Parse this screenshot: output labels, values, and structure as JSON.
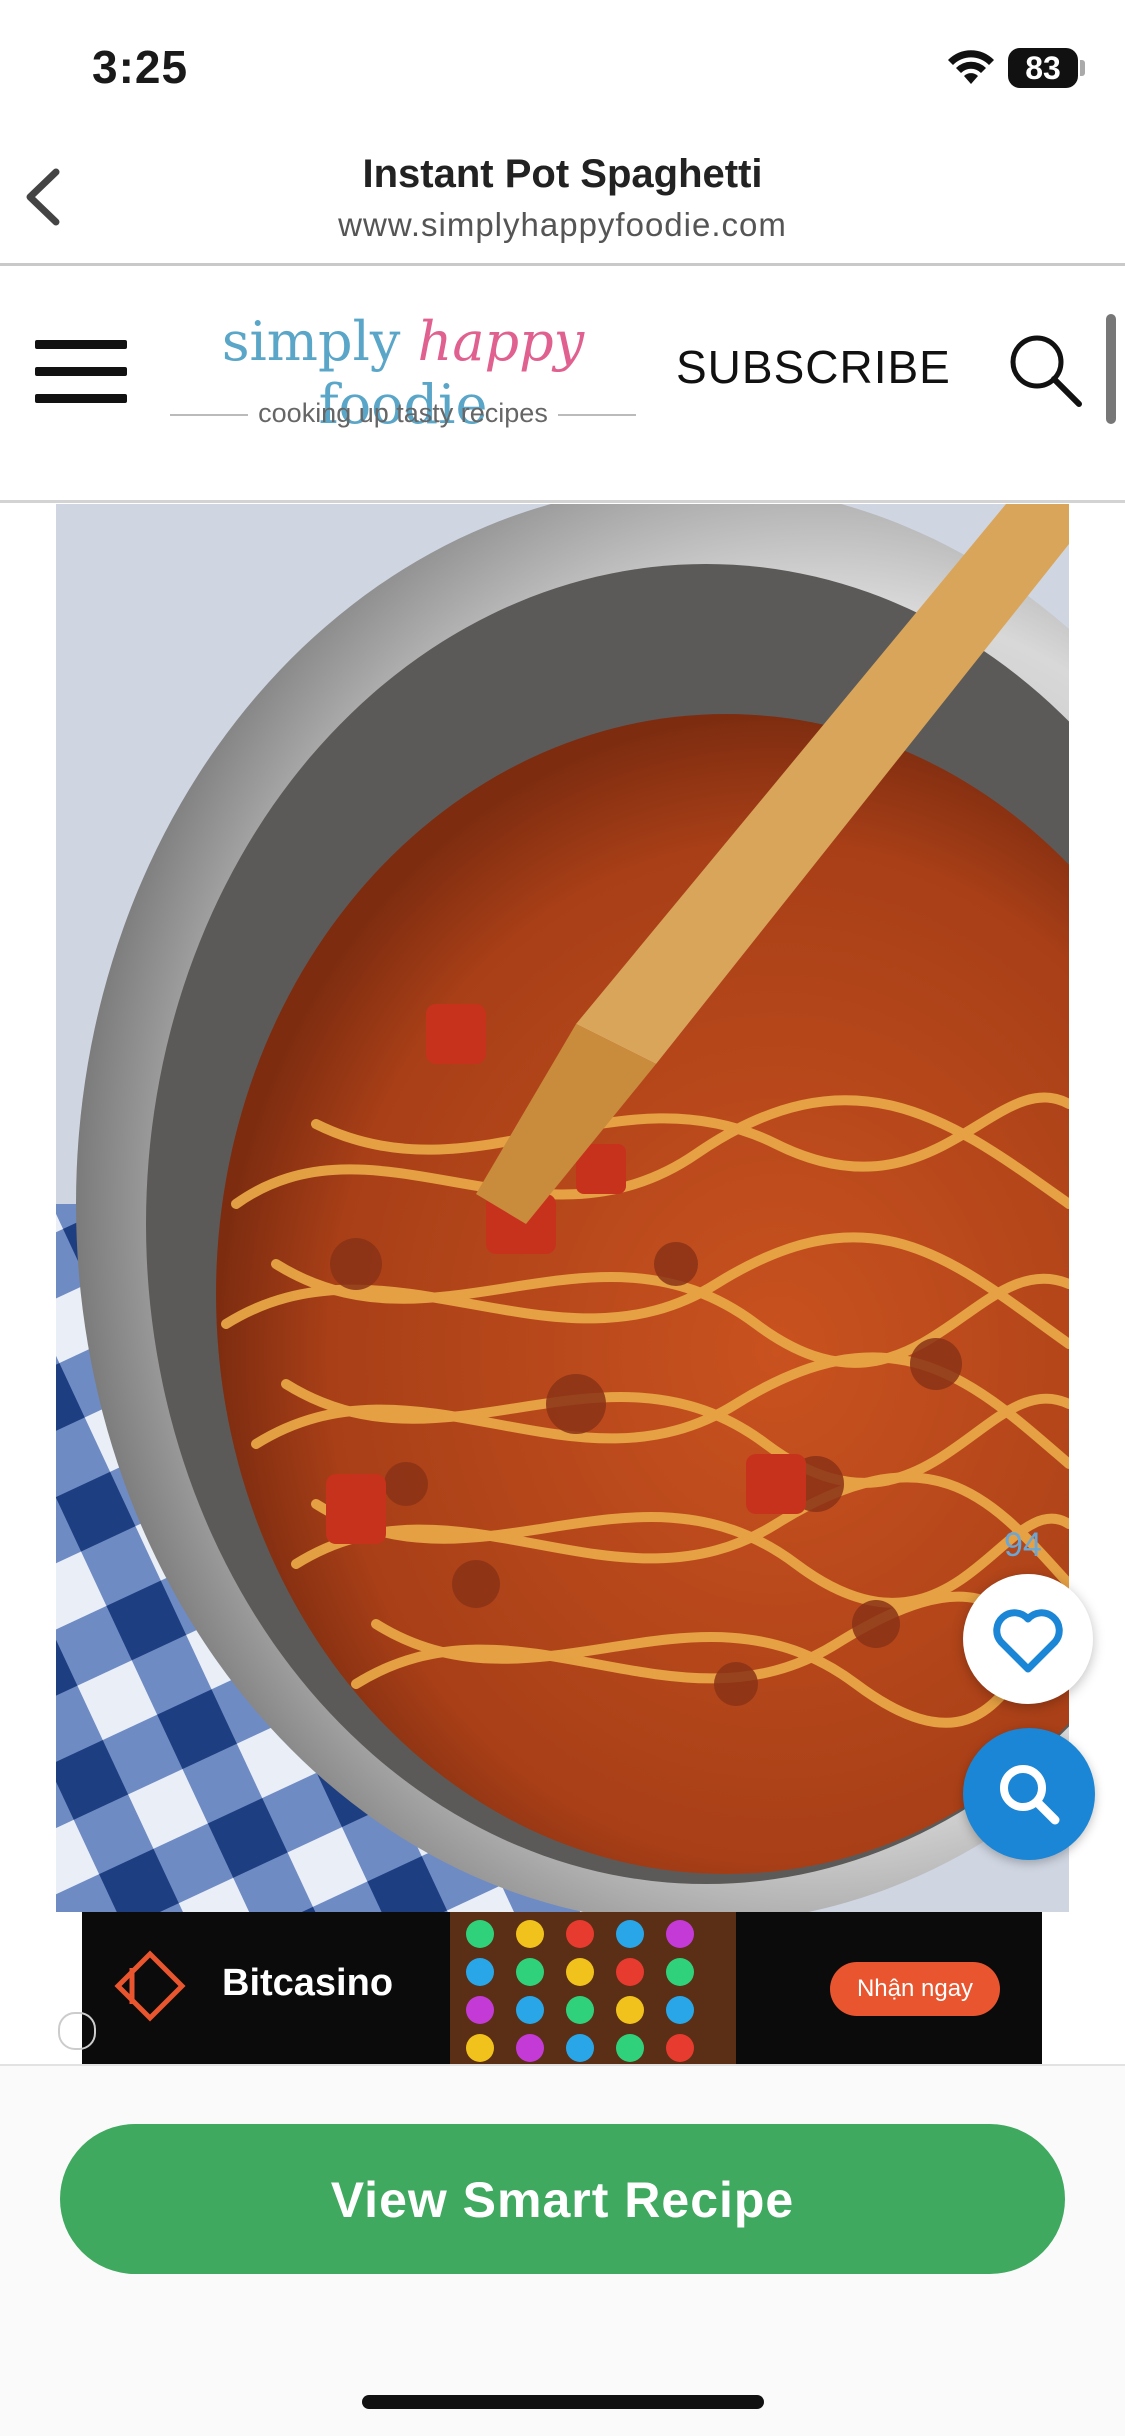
{
  "status_bar": {
    "time": "3:25",
    "battery": "83"
  },
  "nav": {
    "title": "Instant Pot Spaghetti",
    "url": "www.simplyhappyfoodie.com"
  },
  "site_header": {
    "logo_word_1": "simply",
    "logo_word_2": "happy",
    "logo_word_3": "foodie",
    "logo_tagline": "cooking up tasty recipes",
    "subscribe_label": "SUBSCRIBE"
  },
  "floating": {
    "favorite_count": "94"
  },
  "ad": {
    "brand": "Bitcasino",
    "sub": "10̈ ̸",
    "cta": "Nhận ngay"
  },
  "cta": {
    "label": "View Smart Recipe"
  },
  "colors": {
    "cta_green": "#3fa95f",
    "fab_blue": "#1b86d6",
    "logo_blue": "#5aa6c8",
    "logo_pink": "#e0608f"
  },
  "icons": {
    "back": "chevron-left-icon",
    "menu": "hamburger-menu-icon",
    "search": "search-icon",
    "favorite": "heart-icon",
    "fab_search": "search-icon"
  }
}
